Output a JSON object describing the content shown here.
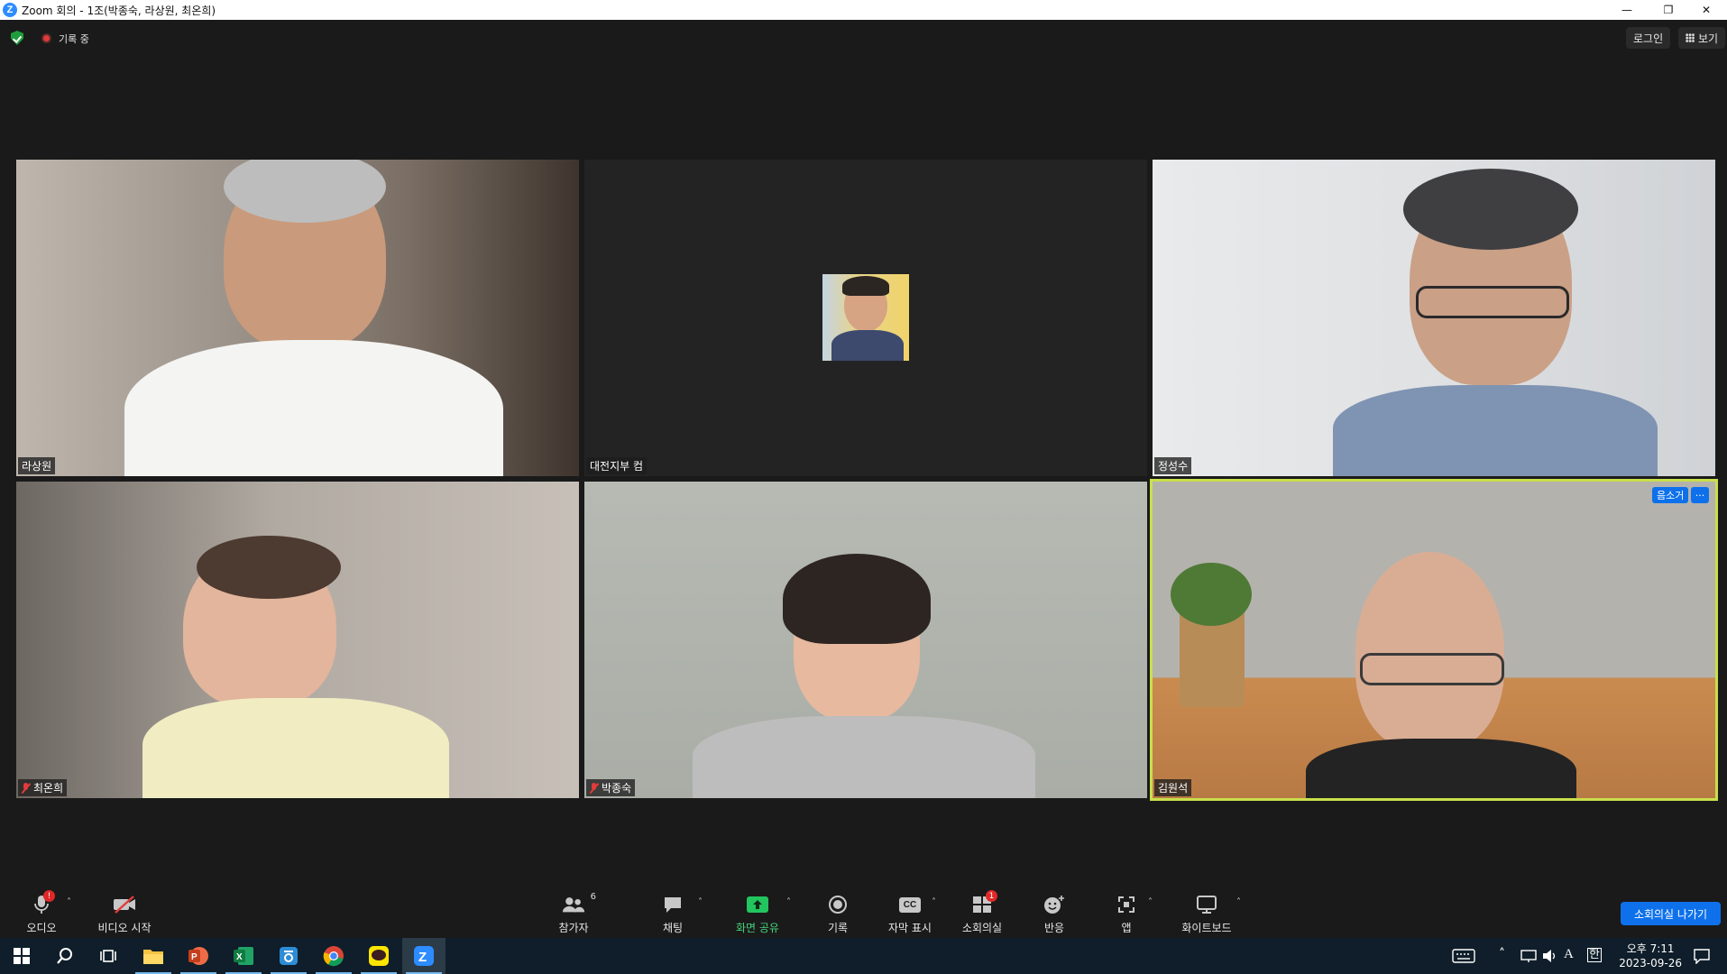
{
  "window": {
    "title": "Zoom 회의 - 1조(박종숙, 라상원, 최온희)",
    "minimize": "—",
    "restore": "❐",
    "close": "✕"
  },
  "topbar": {
    "recording": "기록 중",
    "login": "로그인",
    "view": "보기"
  },
  "tiles": [
    {
      "name": "라상원",
      "muted": false
    },
    {
      "name": "대전지부 컴",
      "muted": false
    },
    {
      "name": "정성수",
      "muted": false
    },
    {
      "name": "최온희",
      "muted": true
    },
    {
      "name": "박종숙",
      "muted": true
    },
    {
      "name": "김원석",
      "muted": false,
      "active": true
    }
  ],
  "active_tile": {
    "unmute_label": "음소거",
    "more_label": "···"
  },
  "toolbar": {
    "audio": "오디오",
    "video": "비디오 시작",
    "participants": "참가자",
    "participants_count": "6",
    "chat": "채팅",
    "share": "화면 공유",
    "record": "기록",
    "captions": "자막 표시",
    "captions_icon": "CC",
    "breakout": "소회의실",
    "breakout_badge": "1",
    "reactions": "반응",
    "apps": "앱",
    "whiteboard": "화이트보드",
    "audio_badge": "!",
    "leave": "소회의실 나가기"
  },
  "taskbar": {
    "time": "오후 7:11",
    "date": "2023-09-26",
    "ime": "A",
    "ime2": "한"
  },
  "colors": {
    "accent": "#0e71eb",
    "active_border": "#c9df4b",
    "share_green": "#22c55e",
    "danger": "#e23b3b"
  }
}
